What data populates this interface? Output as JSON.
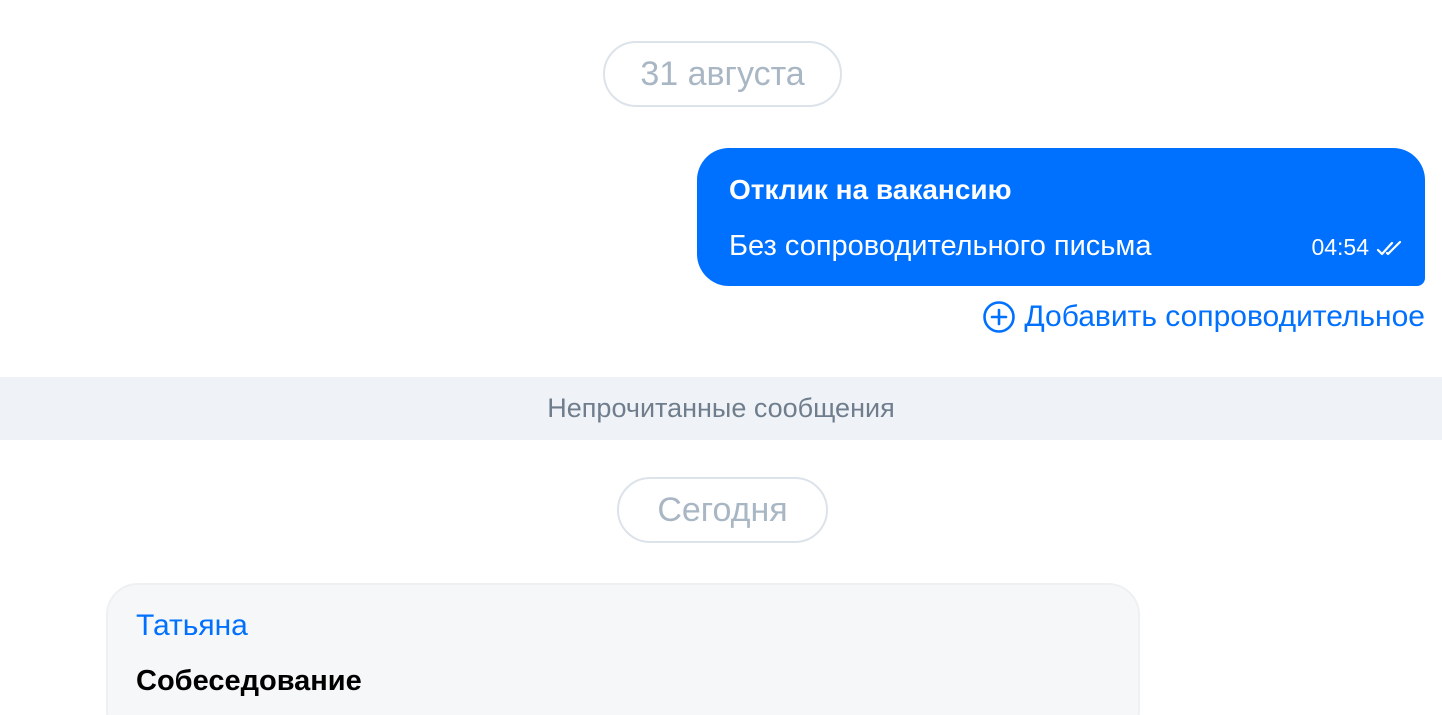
{
  "chat": {
    "date_1": "31 августа",
    "outgoing": {
      "title": "Отклик на вакансию",
      "text": "Без сопроводительного письма",
      "time": "04:54",
      "status_icon": "double-check-icon"
    },
    "add_cover_label": "Добавить сопроводительное",
    "add_cover_icon": "plus-circle-icon",
    "unread_label": "Непрочитанные сообщения",
    "date_2": "Сегодня",
    "incoming": {
      "sender": "Татьяна",
      "title": "Собеседование"
    }
  },
  "colors": {
    "accent": "#0070ff",
    "unread_bar": "#eff3f7",
    "incoming_bubble": "#f6f7f8",
    "date_text": "#a9b6c4"
  }
}
